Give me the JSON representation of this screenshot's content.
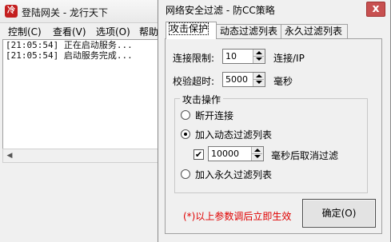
{
  "background_window": {
    "title": "登陆网关 - 龙行天下",
    "app_icon_text": "冷",
    "menu": [
      "控制(C)",
      "查看(V)",
      "选项(O)",
      "帮助"
    ],
    "log": [
      "[21:05:54] 正在启动服务...",
      "[21:05:54] 启动服务完成..."
    ]
  },
  "dialog": {
    "title": "网络安全过滤 - 防CC策略",
    "close_glyph": "x",
    "tabs": [
      "攻击保护",
      "动态过滤列表",
      "永久过滤列表"
    ],
    "active_tab": 0,
    "connection_limit": {
      "label": "连接限制:",
      "value": "10",
      "unit": "连接/IP"
    },
    "verify_timeout": {
      "label": "校验超时:",
      "value": "5000",
      "unit": "毫秒"
    },
    "attack_group": {
      "title": "攻击操作",
      "options": [
        "断开连接",
        "加入动态过滤列表",
        "加入永久过滤列表"
      ],
      "selected_index": 1,
      "cancel_filter": {
        "checked": true,
        "check_glyph": "✔",
        "value": "10000",
        "label": "毫秒后取消过滤"
      }
    },
    "note": "(*)以上参数调后立即生效",
    "ok_button": "确定(O)"
  }
}
